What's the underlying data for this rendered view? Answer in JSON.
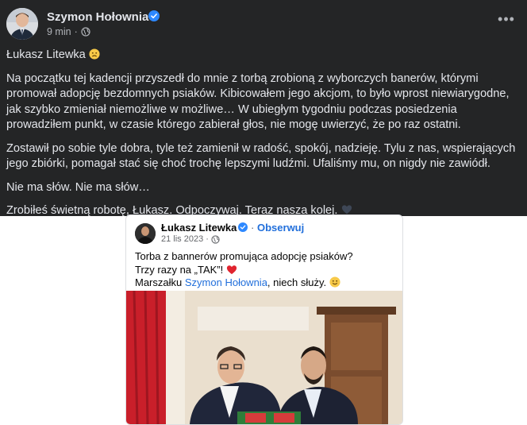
{
  "post": {
    "author": "Szymon Hołownia",
    "time": "9 min",
    "separator": "·",
    "more_label": "•••",
    "paragraphs": {
      "p1": "Łukasz Litewka",
      "p2": "Na początku tej kadencji przyszedł do mnie z torbą zrobioną z wyborczych banerów, którymi promował adopcję bezdomnych psiaków. Kibicowałem jego akcjom, to było wprost niewiarygodne, jak szybko zmieniał niemożliwe w możliwe… W ubiegłym tygodniu podczas posiedzenia prowadziłem punkt, w czasie którego zabierał głos, nie mogę uwierzyć, że po raz ostatni.",
      "p3": "Zostawił po sobie tyle dobra, tyle też zamienił w radość, spokój, nadzieję. Tylu z nas, wspierających jego zbiórki, pomagał stać się choć trochę lepszymi ludźmi. Ufaliśmy mu, on nigdy nie zawiódł.",
      "p4": "Nie ma słów. Nie ma słów…",
      "p5": "Zrobiłeś świetną robotę, Łukasz. Odpoczywaj. Teraz nasza kolej."
    },
    "icons": {
      "verified": "verified-badge-icon",
      "privacy": "globe-icon",
      "sad": "sad-face-emoji",
      "heart": "black-heart-emoji"
    },
    "colors": {
      "background": "#242526",
      "text": "#e4e6eb",
      "secondary": "#b0b3b8",
      "verified": "#2d88ff"
    }
  },
  "shared_post": {
    "author": "Łukasz Litewka",
    "dot": "·",
    "follow_label": "Obserwuj",
    "date": "21 lis 2023",
    "separator": "·",
    "line1": "Torba z bannerów promująca adopcję psiaków?",
    "line2_prefix": "Trzy razy na „TAK”!",
    "line3_prefix": "Marszałku",
    "line3_mention": "Szymon Hołownia",
    "line3_suffix": ", niech służy.",
    "icons": {
      "heart": "red-heart-emoji",
      "smile": "smiling-face-emoji"
    },
    "colors": {
      "link": "#216fdb"
    }
  }
}
